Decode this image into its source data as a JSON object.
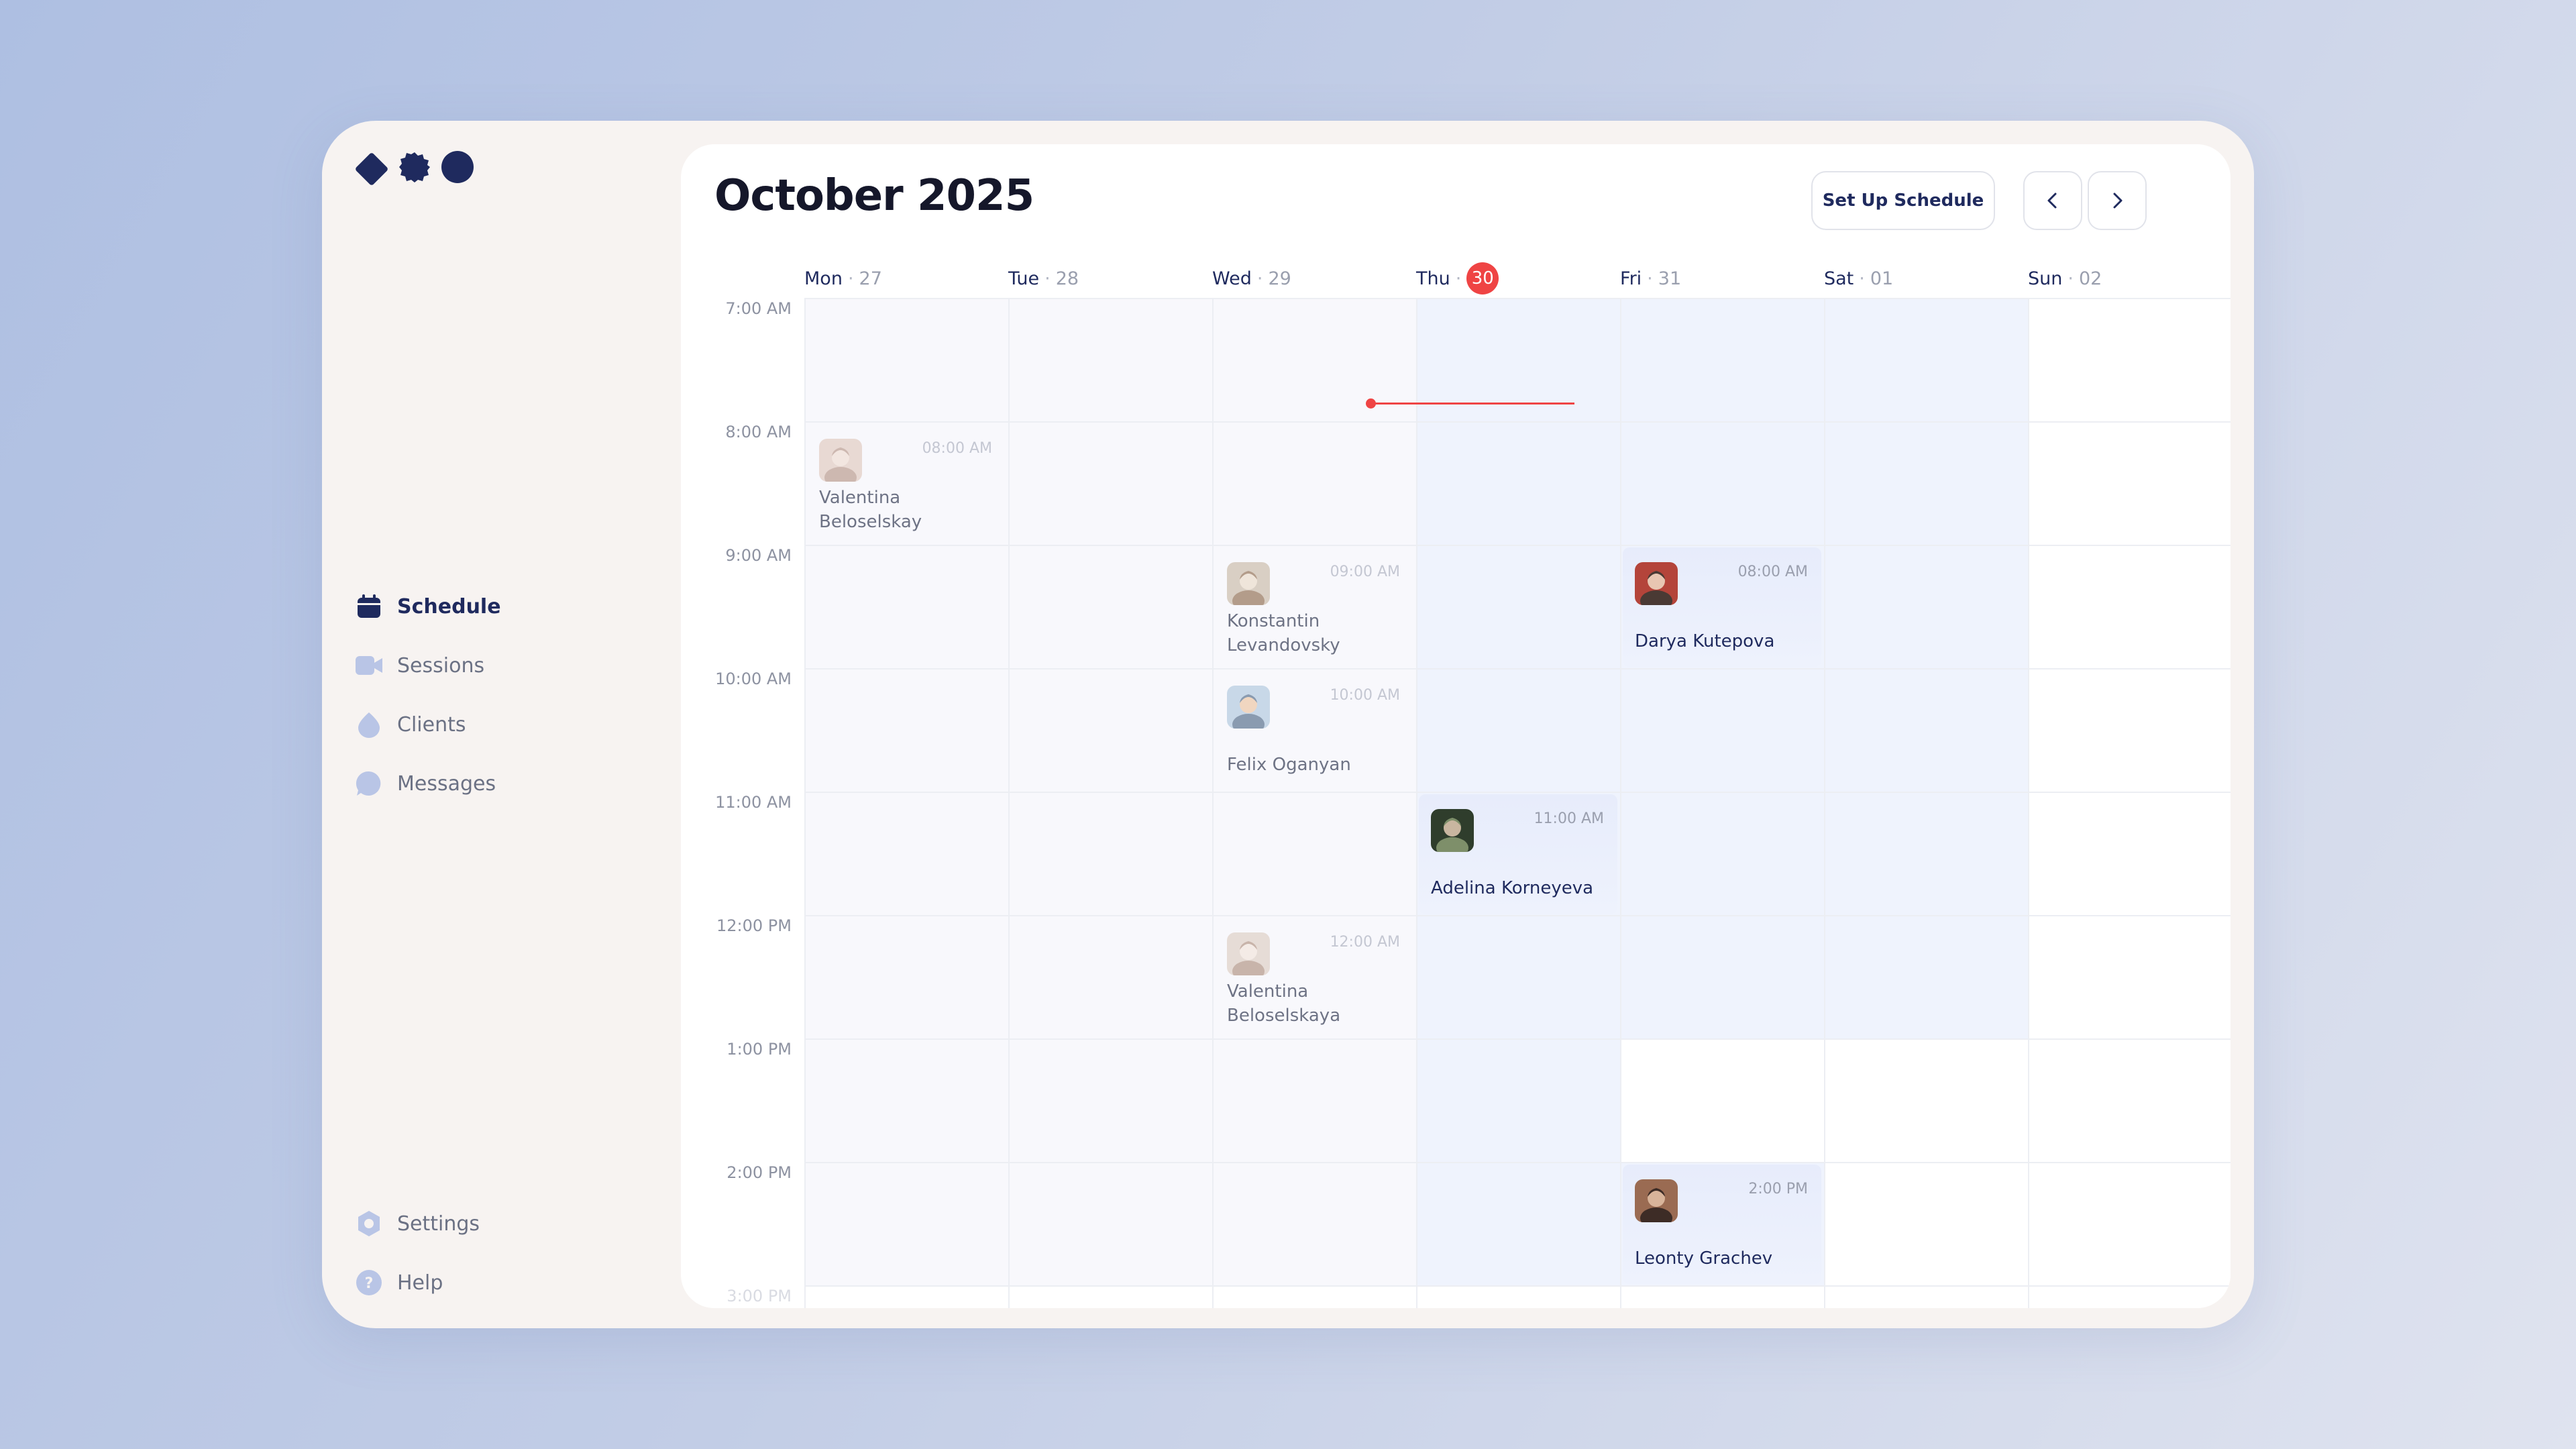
{
  "header": {
    "title": "October 2025",
    "setup_label": "Set Up Schedule"
  },
  "sidebar": {
    "items": [
      {
        "label": "Schedule",
        "icon": "calendar-icon",
        "active": true
      },
      {
        "label": "Sessions",
        "icon": "video-icon"
      },
      {
        "label": "Clients",
        "icon": "drop-icon"
      },
      {
        "label": "Messages",
        "icon": "chat-bubble-icon"
      }
    ],
    "bottom": [
      {
        "label": "Settings",
        "icon": "gear-icon"
      },
      {
        "label": "Help",
        "icon": "help-icon"
      }
    ]
  },
  "days": [
    {
      "name": "Mon",
      "num": "27"
    },
    {
      "name": "Tue",
      "num": "28"
    },
    {
      "name": "Wed",
      "num": "29"
    },
    {
      "name": "Thu",
      "num": "30",
      "today": true
    },
    {
      "name": "Fri",
      "num": "31"
    },
    {
      "name": "Sat",
      "num": "01"
    },
    {
      "name": "Sun",
      "num": "02"
    }
  ],
  "times": [
    "7:00 AM",
    "8:00 AM",
    "9:00 AM",
    "10:00 AM",
    "11:00 AM",
    "12:00 PM",
    "1:00 PM",
    "2:00 PM",
    "3:00 PM"
  ],
  "events": [
    {
      "day": 0,
      "hour": 1,
      "time": "08:00 AM",
      "name": "Valentina Beloselskay",
      "name_lines": [
        "Valentina",
        "Beloselskay"
      ],
      "style": "muted"
    },
    {
      "day": 2,
      "hour": 2,
      "time": "09:00 AM",
      "name": "Konstantin Levandovsky",
      "name_lines": [
        "Konstantin",
        "Levandovsky"
      ],
      "style": "muted"
    },
    {
      "day": 2,
      "hour": 3,
      "time": "10:00 AM",
      "name": "Felix Oganyan",
      "name_lines": [
        "Felix Oganyan"
      ],
      "style": "muted"
    },
    {
      "day": 2,
      "hour": 5,
      "time": "12:00 AM",
      "name": "Valentina Beloselskaya",
      "name_lines": [
        "Valentina",
        "Beloselskaya"
      ],
      "style": "muted"
    },
    {
      "day": 3,
      "hour": 4,
      "time": "11:00 AM",
      "name": "Adelina Korneyeva",
      "name_lines": [
        "Adelina Korneyeva"
      ],
      "style": "strong"
    },
    {
      "day": 4,
      "hour": 2,
      "time": "08:00 AM",
      "name": "Darya Kutepova",
      "name_lines": [
        "Darya Kutepova"
      ],
      "style": "strong"
    },
    {
      "day": 4,
      "hour": 7,
      "time": "2:00 PM",
      "name": "Leonty Grachev",
      "name_lines": [
        "Leonty Grachev"
      ],
      "style": "strong"
    }
  ],
  "colors": {
    "accent": "#1f2a5e",
    "today": "#ef4444",
    "past_cell": "#f8f8fc",
    "highlight_cell": "#eff3fd"
  }
}
